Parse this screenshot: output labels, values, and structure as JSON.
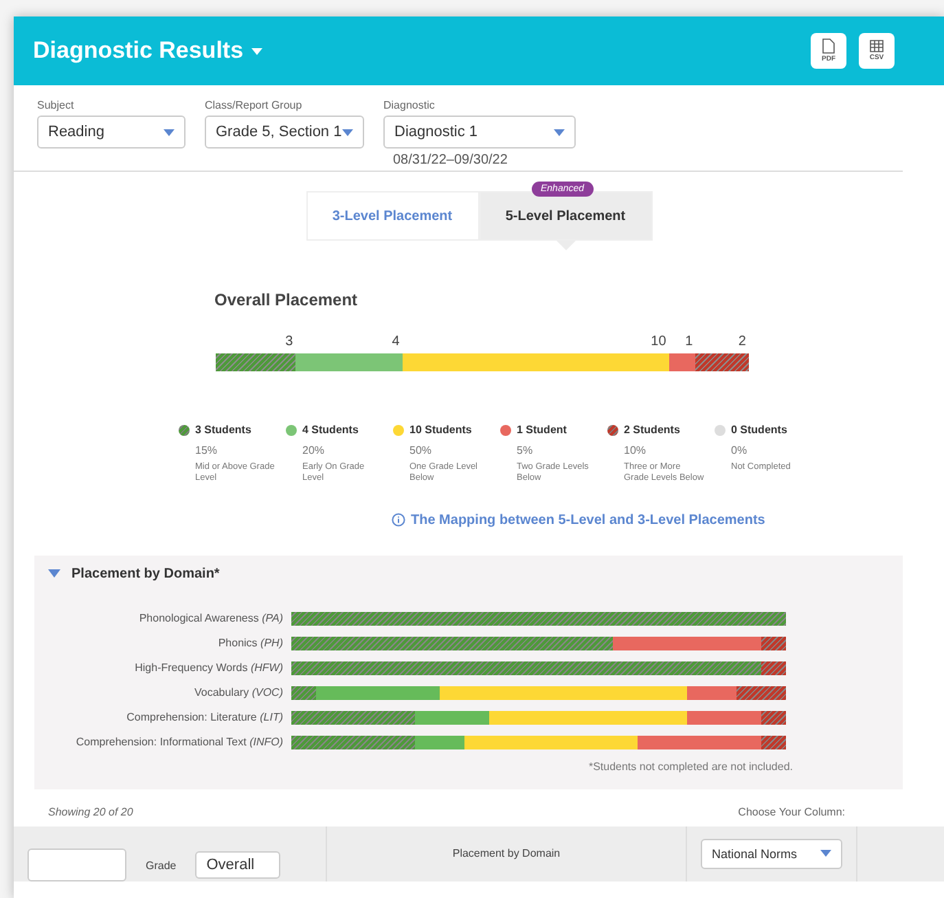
{
  "header": {
    "title": "Diagnostic Results",
    "buttons": [
      {
        "kind": "pdf",
        "label": "PDF"
      },
      {
        "kind": "csv",
        "label": "CSV"
      }
    ]
  },
  "filters": [
    {
      "label": "Subject",
      "value": "Reading"
    },
    {
      "label": "Class/Report Group",
      "value": "Grade 5, Section 1"
    },
    {
      "label": "Diagnostic",
      "value": "Diagnostic 1",
      "note": "08/31/22–09/30/22"
    }
  ],
  "tabs": [
    {
      "label": "3-Level Placement",
      "selected": false
    },
    {
      "label": "5-Level Placement",
      "selected": true,
      "badge": "Enhanced"
    }
  ],
  "overall": {
    "title": "Overall Placement",
    "segments": [
      {
        "count": "3",
        "kind": "hatched",
        "color": "#4e9a3a"
      },
      {
        "count": "4",
        "kind": "solid",
        "color": "#7cc576"
      },
      {
        "count": "10",
        "kind": "solid",
        "color": "#fdd835"
      },
      {
        "count": "1",
        "kind": "solid",
        "color": "#e8685f"
      },
      {
        "count": "2",
        "kind": "hatched",
        "color": "#c0392b"
      }
    ]
  },
  "legend": [
    {
      "kind": "hatched",
      "color": "#4e9a3a",
      "count": "3 Students",
      "percent": "15%",
      "description": "Mid or Above Grade Level"
    },
    {
      "kind": "solid",
      "color": "#7cc576",
      "count": "4 Students",
      "percent": "20%",
      "description": "Early On Grade Level"
    },
    {
      "kind": "solid",
      "color": "#fdd835",
      "count": "10 Students",
      "percent": "50%",
      "description": "One Grade Level Below"
    },
    {
      "kind": "solid",
      "color": "#e8685f",
      "count": "1 Student",
      "percent": "5%",
      "description": "Two Grade Levels Below"
    },
    {
      "kind": "hatched",
      "color": "#c0392b",
      "count": "2 Students",
      "percent": "10%",
      "description": "Three or More Grade Levels Below"
    },
    {
      "kind": "solid",
      "color": "#dddddd",
      "count": "0 Students",
      "percent": "0%",
      "description": "Not Completed"
    }
  ],
  "mapping_link": "The Mapping between 5-Level and 3-Level Placements",
  "domain": {
    "title": "Placement by Domain*",
    "expanded": true,
    "note": "*Students not completed are not included.",
    "rows": [
      {
        "name": "Phonological Awareness",
        "abbr": "(PA)"
      },
      {
        "name": "Phonics",
        "abbr": "(PH)"
      },
      {
        "name": "High-Frequency Words",
        "abbr": "(HFW)"
      },
      {
        "name": "Vocabulary",
        "abbr": "(VOC)"
      },
      {
        "name": "Comprehension: Literature",
        "abbr": "(LIT)"
      },
      {
        "name": "Comprehension: Informational Text",
        "abbr": "(INFO)"
      }
    ]
  },
  "showing": "Showing 20 of 20",
  "column_chooser": {
    "label": "Choose Your Column:",
    "value": "National Norms"
  },
  "table_header": {
    "grade_label": "Grade",
    "grade_value": "Overall",
    "column_2": "Placement by Domain"
  }
}
